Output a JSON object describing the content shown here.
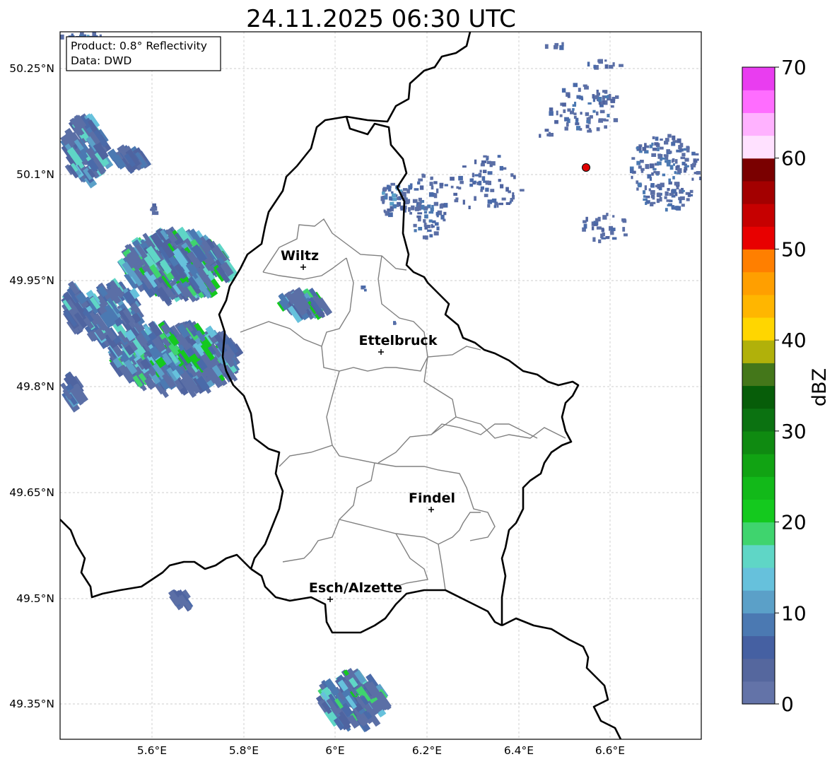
{
  "title": "24.11.2025 06:30 UTC",
  "info_box": {
    "product": "Product: 0.8° Reflectivity",
    "data_source": "Data: DWD"
  },
  "lat_labels": [
    "50.25°N",
    "50.1°N",
    "49.95°N",
    "49.8°N",
    "49.65°N",
    "49.5°N",
    "49.35°N"
  ],
  "lon_labels": [
    "5.6°E",
    "5.8°E",
    "6°E",
    "6.2°E",
    "6.4°E",
    "6.6°E"
  ],
  "cities": [
    {
      "name": "Wiltz"
    },
    {
      "name": "Ettelbruck"
    },
    {
      "name": "Findel"
    },
    {
      "name": "Esch/Alzette"
    }
  ],
  "colorbar": {
    "label": "dBZ",
    "ticks": [
      "0",
      "10",
      "20",
      "30",
      "40",
      "50",
      "60",
      "70"
    ],
    "min": 0,
    "max": 70,
    "colors": [
      "#6373a8",
      "#55679e",
      "#4560a2",
      "#4b79b2",
      "#5ba0c8",
      "#66c1dc",
      "#5fd6c6",
      "#3fd46e",
      "#14c91e",
      "#12b919",
      "#11a313",
      "#0f8a11",
      "#0b7211",
      "#075d09",
      "#44771a",
      "#b1b10a",
      "#ffd600",
      "#ffb600",
      "#ff9f00",
      "#ff7f00",
      "#e80000",
      "#c60000",
      "#a30000",
      "#7a0000",
      "#ffe1ff",
      "#ffb2ff",
      "#ff6dff",
      "#e93df0"
    ]
  },
  "legend_colors": {
    "border": "#000000",
    "canton": "#808080",
    "radar_site": "#e00000"
  }
}
